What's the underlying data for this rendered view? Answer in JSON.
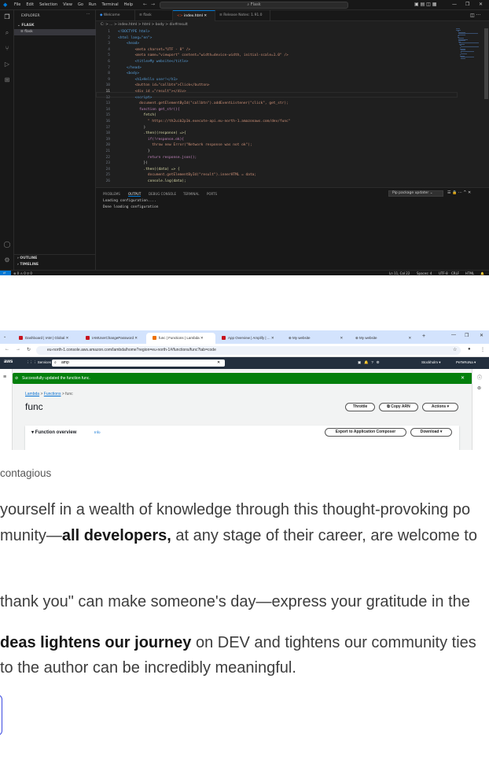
{
  "vscode": {
    "menu": [
      "File",
      "Edit",
      "Selection",
      "View",
      "Go",
      "Run",
      "Terminal",
      "Help"
    ],
    "command_center": "Flask",
    "explorer_title": "EXPLORER",
    "folder": "FLASK",
    "file": "flask",
    "outline": "OUTLINE",
    "timeline": "TIMELINE",
    "tabs": [
      "Welcome",
      "flask",
      "index.html",
      "Release Notes: 1.91.0"
    ],
    "breadcrumb": "C: > ... > index.html > html > body > div#result",
    "code_lines": [
      {
        "n": "1",
        "t": "<!DOCTYPE html>"
      },
      {
        "n": "2",
        "t": "<html lang=\"en\">"
      },
      {
        "n": "3",
        "t": "    <head>"
      },
      {
        "n": "4",
        "t": "        <meta charset=\"UTF - 8\" />"
      },
      {
        "n": "5",
        "t": "        <meta name=\"viewport\" content=\"width=device-width, initial-scale=1.0\" />"
      },
      {
        "n": "6",
        "t": "        <title>My website</title>"
      },
      {
        "n": "7",
        "t": "    </head>"
      },
      {
        "n": "8",
        "t": "    <body>"
      },
      {
        "n": "9",
        "t": "        <h1>Hello user!</h1>"
      },
      {
        "n": "10",
        "t": "        <button id=\"callbtn\">Click</button>"
      },
      {
        "n": "11",
        "t": "        <div id =\"result\"></div>"
      },
      {
        "n": "12",
        "t": "        <script>"
      },
      {
        "n": "13",
        "t": "          document.getElementById(\"callbtn\").addEventListener(\"click\", get_str);"
      },
      {
        "n": "14",
        "t": "          function get_str(){"
      },
      {
        "n": "15",
        "t": "            fetch("
      },
      {
        "n": "16",
        "t": "              \" https://th2uib2p1k.execute-api.eu-north-1.amazonaws.com/dev/func\""
      },
      {
        "n": "17",
        "t": "            )"
      },
      {
        "n": "18",
        "t": "            .then((response) =>{"
      },
      {
        "n": "19",
        "t": "              if(!response.ok){"
      },
      {
        "n": "20",
        "t": "                throw new Error(\"Network response was not ok\");"
      },
      {
        "n": "21",
        "t": "              }"
      },
      {
        "n": "22",
        "t": "              return response.json();"
      },
      {
        "n": "23",
        "t": "            })"
      },
      {
        "n": "24",
        "t": "            .then((data) => {"
      },
      {
        "n": "25",
        "t": "              document.getElementById(\"result\").innerHTML = data;"
      },
      {
        "n": "26",
        "t": "              console.log(data);"
      }
    ],
    "panel_tabs": [
      "PROBLEMS",
      "OUTPUT",
      "DEBUG CONSOLE",
      "TERMINAL",
      "PORTS"
    ],
    "panel_dropdown": "Pip package updater",
    "output_lines": [
      "Loading configuration....",
      "Done loading configuration"
    ],
    "status_left": "⊗ 0 ⚠ 0   ⚲ 0",
    "status_right": [
      "Ln 11, Col 22",
      "Spaces: 4",
      "UTF-8",
      "CRLF",
      "HTML"
    ]
  },
  "browser": {
    "tabs": [
      "Dashboard | IAM | Global",
      "IAMUserChangePassword",
      "func | Functions | Lambda",
      "App Overview | Amplify | ...",
      "My website",
      "My website"
    ],
    "url": "eu-north-1.console.aws.amazon.com/lambda/home?region=eu-north-1#/functions/func?tab=code",
    "services": "Services",
    "search_value": "amp",
    "region": "Stockholm",
    "account": "PeTeRoNa",
    "flash": "Successfully updated the function func.",
    "breadcrumb": [
      "Lambda",
      "Functions",
      "func"
    ],
    "title": "func",
    "buttons": [
      "Throttle",
      "Copy ARN",
      "Actions"
    ],
    "overview": "Function overview",
    "info": "Info",
    "export_btn": "Export to Application Composer",
    "download_btn": "Download"
  },
  "article": {
    "caption": " contagious",
    "p1_l1": "yourself in a wealth of knowledge through this thought-provoking po",
    "p1_l2a": "munity—",
    "p1_l2b": "all developers,",
    "p1_l2c": " at any stage of their career, are welcome to",
    "p2": " thank you\" can make someone's day—express your gratitude in the",
    "p3_b": "deas lightens our journey",
    "p3_rest": " on DEV and tightens our community ties",
    "p3_l2": "to the author can be incredibly meaningful."
  }
}
